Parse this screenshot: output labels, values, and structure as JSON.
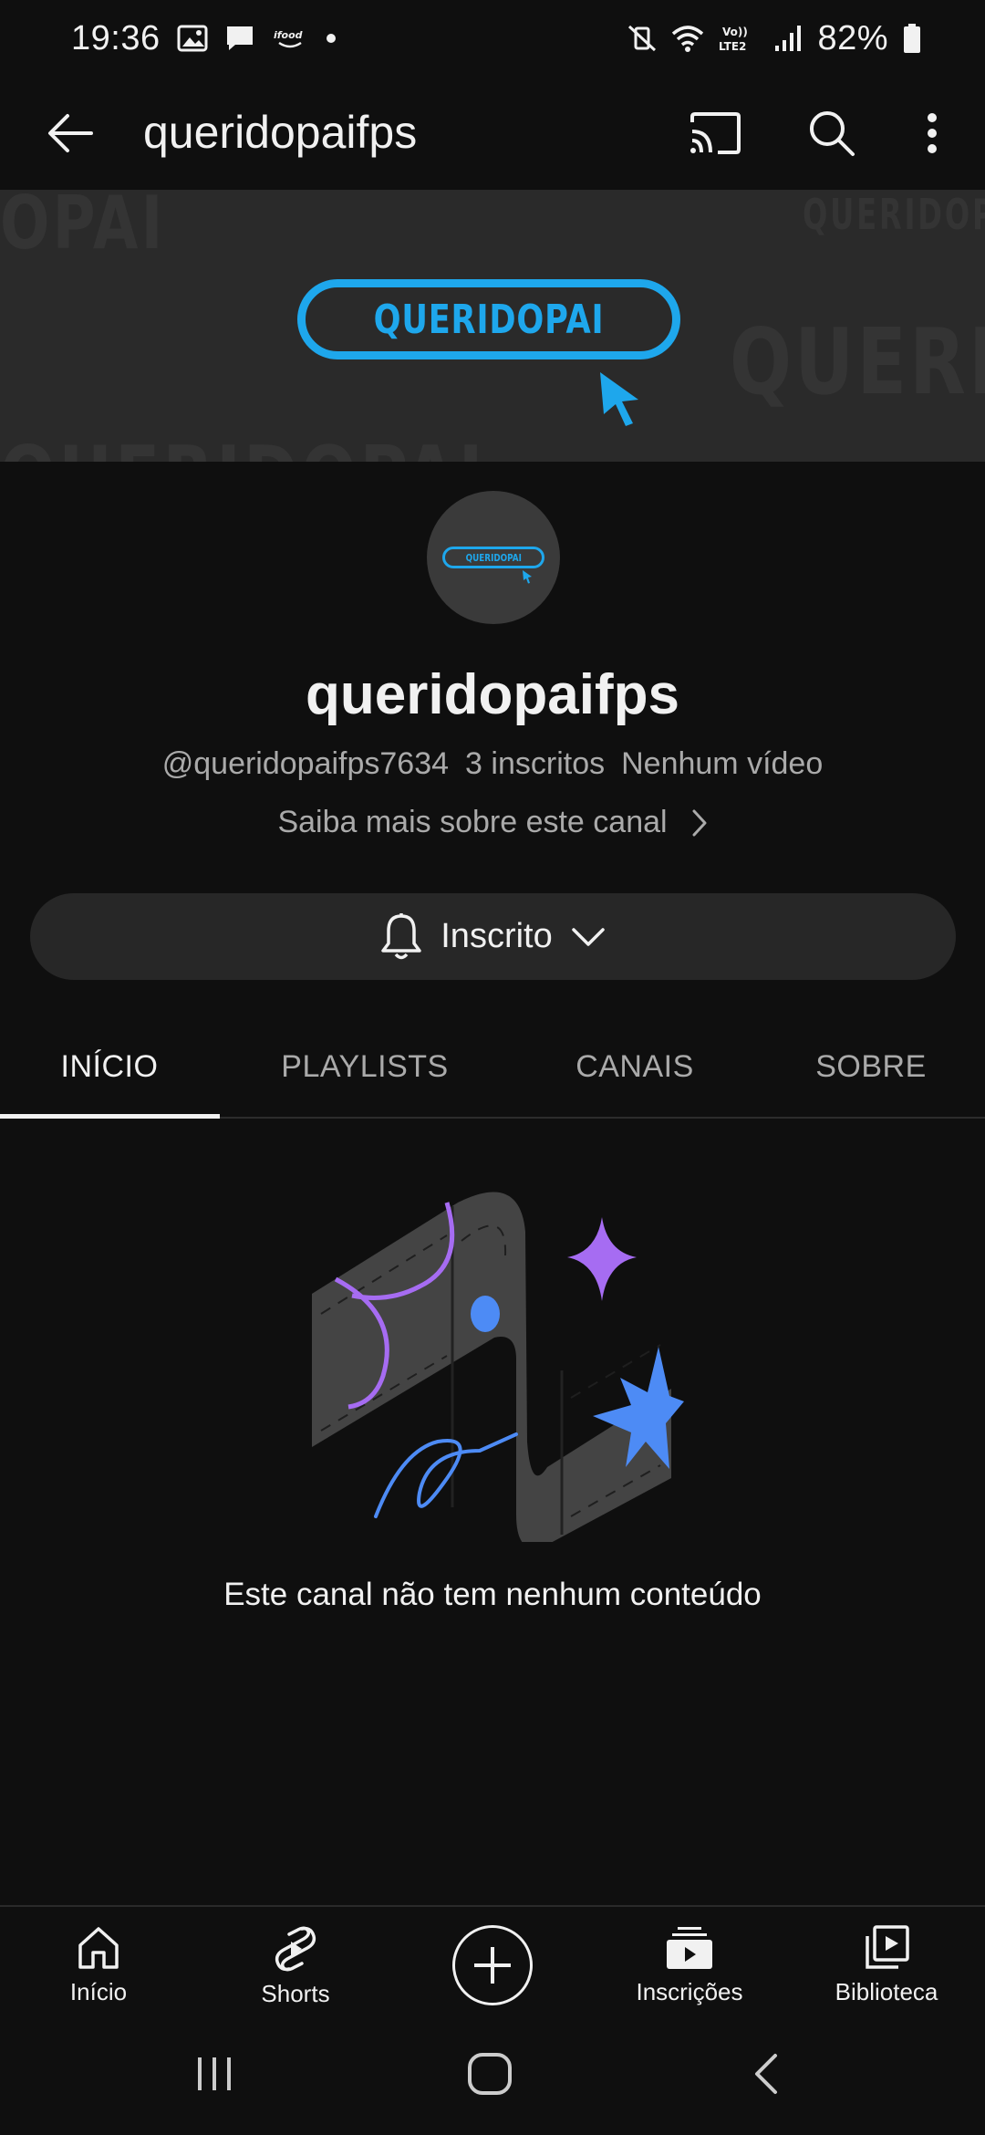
{
  "status_bar": {
    "time": "19:36",
    "battery": "82%",
    "network": "Vo)) LTE2"
  },
  "header": {
    "title": "queridopaifps",
    "icons": [
      "back-arrow-icon",
      "cast-icon",
      "search-icon",
      "more-vert-icon"
    ]
  },
  "banner": {
    "logo_text": "QUERIDOPAI",
    "watermarks": [
      "OPAI",
      "QUERIDOPAI",
      "QUERID",
      "QUERIDOPAI"
    ],
    "accent_color": "#1ea7ec"
  },
  "avatar": {
    "logo_text": "QUERIDOPAI"
  },
  "channel": {
    "name": "queridopaifps",
    "handle": "@queridopaifps7634",
    "subscribers": "3 inscritos",
    "videos": "Nenhum vídeo",
    "about_link": "Saiba mais sobre este canal"
  },
  "subscribe": {
    "label": "Inscrito"
  },
  "tabs": [
    {
      "label": "INÍCIO",
      "active": true
    },
    {
      "label": "PLAYLISTS",
      "active": false
    },
    {
      "label": "CANAIS",
      "active": false
    },
    {
      "label": "SOBRE",
      "active": false
    }
  ],
  "empty_state": {
    "message": "Este canal não tem nenhum conteúdo"
  },
  "bottom_nav": [
    {
      "label": "Início",
      "icon": "home-icon"
    },
    {
      "label": "Shorts",
      "icon": "shorts-icon"
    },
    {
      "label": "",
      "icon": "create-plus-icon"
    },
    {
      "label": "Inscrições",
      "icon": "subscriptions-icon"
    },
    {
      "label": "Biblioteca",
      "icon": "library-icon"
    }
  ],
  "system_nav": [
    "recents-icon",
    "home-circle-icon",
    "back-chevron-icon"
  ]
}
